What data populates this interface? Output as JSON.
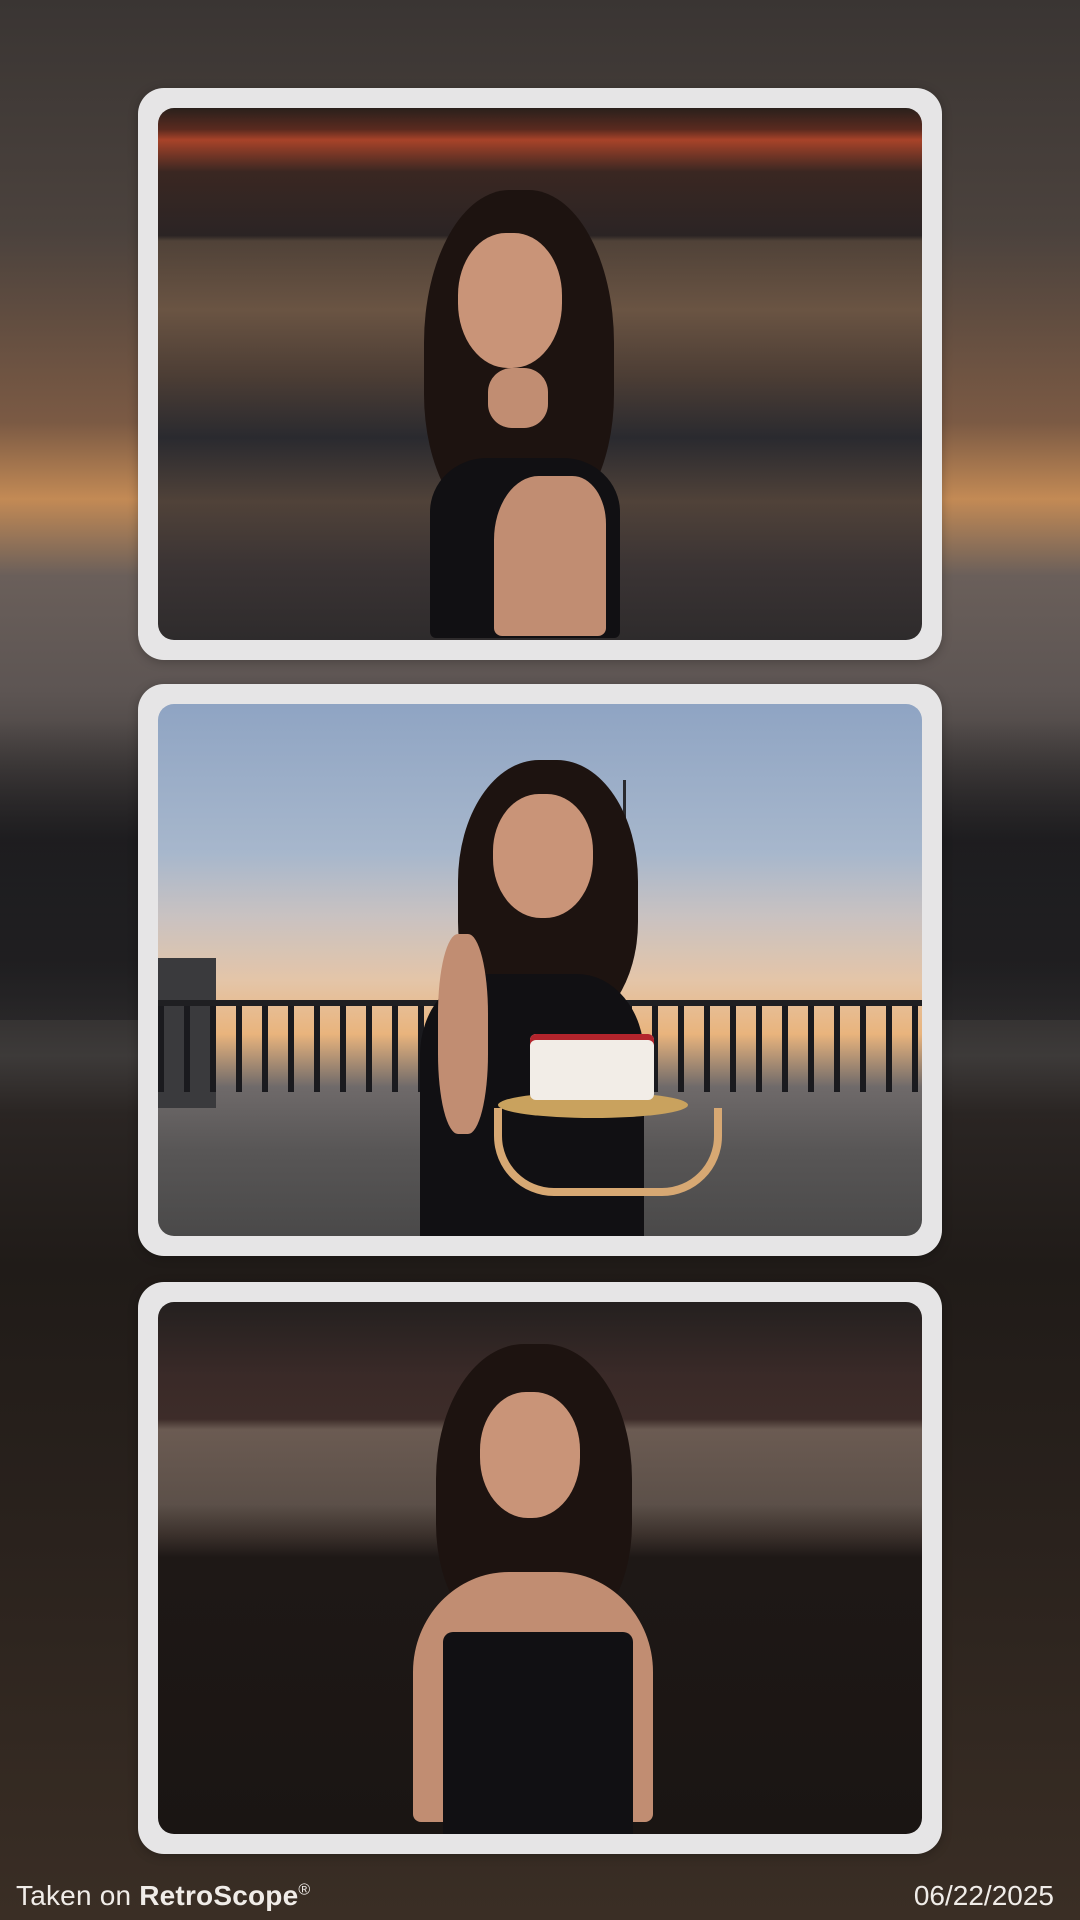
{
  "footer": {
    "prefix": "Taken on",
    "brand": "RetroScope",
    "trademark": "®",
    "date": "06/22/2025"
  },
  "photos": [
    {
      "icon": "photo-portrait-sea-sunset"
    },
    {
      "icon": "photo-portrait-with-cake"
    },
    {
      "icon": "photo-portrait-beach-dusk"
    }
  ],
  "colors": {
    "card_frame": "#e6e5e6",
    "footer_text": "#f0ece8"
  }
}
